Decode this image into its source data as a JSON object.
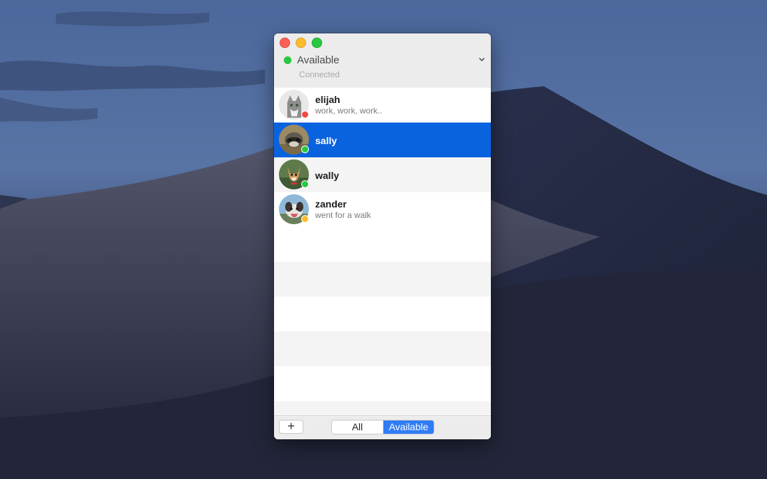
{
  "window": {
    "status": {
      "label": "Available",
      "color": "#28c840"
    },
    "connection_text": "Connected"
  },
  "contacts": [
    {
      "name": "elijah",
      "status_message": "work, work, work..",
      "presence": "busy",
      "presence_color": "#f04a43",
      "avatar": "cat-avatar-icon",
      "selected": false
    },
    {
      "name": "sally",
      "status_message": "",
      "presence": "available",
      "presence_color": "#28c840",
      "avatar": "raccoon-avatar-icon",
      "selected": true
    },
    {
      "name": "wally",
      "status_message": "",
      "presence": "available",
      "presence_color": "#28c840",
      "avatar": "dog-avatar-icon",
      "selected": false
    },
    {
      "name": "zander",
      "status_message": "went for a walk",
      "presence": "away",
      "presence_color": "#fdbc2e",
      "avatar": "dog-avatar-icon",
      "selected": false
    }
  ],
  "bottombar": {
    "add_label": "+",
    "filter_options": [
      "All",
      "Available"
    ],
    "filter_selected": "Available"
  },
  "colors": {
    "selection": "#0a63de",
    "accent": "#2f7cf6"
  }
}
